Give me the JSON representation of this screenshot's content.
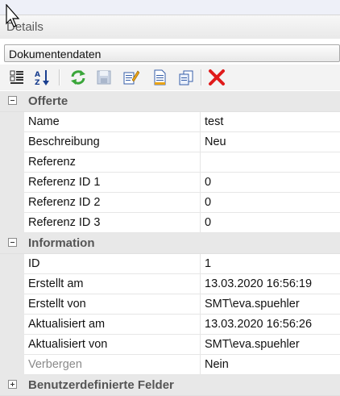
{
  "panel": {
    "title": "Details"
  },
  "selector": {
    "value": "Dokumentendaten"
  },
  "toolbar": {
    "icons": [
      "categorized-icon",
      "alphabetical-icon",
      "refresh-icon",
      "save-icon",
      "edit-icon",
      "document-icon",
      "copy-icon",
      "delete-icon"
    ]
  },
  "categories": [
    {
      "label": "Offerte",
      "expanded": true,
      "rows": [
        {
          "name": "Name",
          "value": "test"
        },
        {
          "name": "Beschreibung",
          "value": "Neu"
        },
        {
          "name": "Referenz",
          "value": ""
        },
        {
          "name": "Referenz ID 1",
          "value": "0"
        },
        {
          "name": "Referenz ID 2",
          "value": "0"
        },
        {
          "name": "Referenz ID 3",
          "value": "0"
        }
      ]
    },
    {
      "label": "Information",
      "expanded": true,
      "rows": [
        {
          "name": "ID",
          "value": "1"
        },
        {
          "name": "Erstellt am",
          "value": "13.03.2020 16:56:19"
        },
        {
          "name": "Erstellt von",
          "value": "SMT\\eva.spuehler"
        },
        {
          "name": "Aktualisiert am",
          "value": "13.03.2020 16:56:26"
        },
        {
          "name": "Aktualisiert von",
          "value": "SMT\\eva.spuehler"
        },
        {
          "name": "Verbergen",
          "value": "Nein",
          "readonly": true
        }
      ]
    },
    {
      "label": "Benutzerdefinierte Felder",
      "expanded": false,
      "rows": []
    }
  ]
}
